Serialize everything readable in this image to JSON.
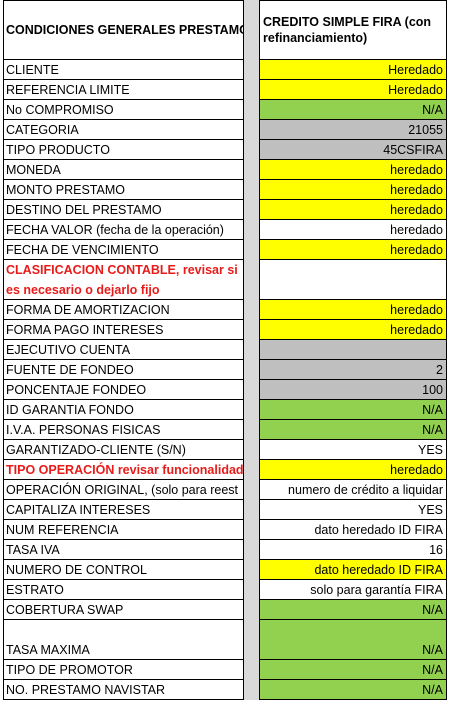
{
  "header": {
    "left": "CONDICIONES GENERALES PRESTAMO",
    "right": "CREDITO SIMPLE FIRA (con refinanciamiento)"
  },
  "rows": [
    {
      "label": "CLIENTE",
      "value": "Heredado",
      "fill": "#ffff00"
    },
    {
      "label": "REFERENCIA LIMITE",
      "value": "Heredado",
      "fill": "#ffff00"
    },
    {
      "label": "No COMPROMISO",
      "value": "N/A",
      "fill": "#92d050"
    },
    {
      "label": "CATEGORIA",
      "value": "21055",
      "fill": "#bfbfbf"
    },
    {
      "label": "TIPO PRODUCTO",
      "value": "45CSFIRA",
      "fill": "#bfbfbf"
    },
    {
      "label": "MONEDA",
      "value": "heredado",
      "fill": "#ffff00"
    },
    {
      "label": "MONTO PRESTAMO",
      "value": "heredado",
      "fill": "#ffff00"
    },
    {
      "label": "DESTINO DEL PRESTAMO",
      "value": "heredado",
      "fill": "#ffff00"
    },
    {
      "label": "FECHA VALOR (fecha de la operación)",
      "value": "heredado",
      "fill": "#ffffff"
    },
    {
      "label": "FECHA DE VENCIMIENTO",
      "value": "heredado",
      "fill": "#ffff00"
    },
    {
      "label": "CLASIFICACION CONTABLE, revisar si es necesario o dejarlo fijo",
      "value": "",
      "fill": "#ffffff",
      "red": true
    },
    {
      "label": "FORMA DE AMORTIZACION",
      "value": "heredado",
      "fill": "#ffff00"
    },
    {
      "label": "FORMA PAGO INTERESES",
      "value": "heredado",
      "fill": "#ffff00"
    },
    {
      "label": "EJECUTIVO CUENTA",
      "value": "",
      "fill": "#bfbfbf"
    },
    {
      "label": "FUENTE DE FONDEO",
      "value": "2",
      "fill": "#bfbfbf"
    },
    {
      "label": "PONCENTAJE FONDEO",
      "value": "100",
      "fill": "#bfbfbf"
    },
    {
      "label": "ID GARANTIA FONDO",
      "value": "N/A",
      "fill": "#92d050"
    },
    {
      "label": "I.V.A. PERSONAS FISICAS",
      "value": "N/A",
      "fill": "#92d050"
    },
    {
      "label": "GARANTIZADO-CLIENTE (S/N)",
      "value": "YES",
      "fill": "#ffffff"
    },
    {
      "label": "TIPO OPERACIÓN revisar funcionalidad",
      "value": "heredado",
      "fill": "#ffff00",
      "red": true
    },
    {
      "label": "OPERACIÓN ORIGINAL, (solo para reest",
      "value": "numero de crédito a liquidar",
      "fill": "#ffffff"
    },
    {
      "label": "CAPITALIZA INTERESES",
      "value": "YES",
      "fill": "#ffffff"
    },
    {
      "label": "NUM REFERENCIA",
      "value": "dato heredado ID FIRA",
      "fill": "#ffffff"
    },
    {
      "label": "TASA IVA",
      "value": "16",
      "fill": "#ffffff"
    },
    {
      "label": "NUMERO DE CONTROL",
      "value": "dato heredado ID FIRA",
      "fill": "#ffff00"
    },
    {
      "label": "ESTRATO",
      "value": "solo para garantía FIRA",
      "fill": "#ffffff"
    },
    {
      "label": "COBERTURA SWAP",
      "value": "N/A",
      "fill": "#92d050"
    },
    {
      "label": "TASA MAXIMA",
      "value": "N/A",
      "fill": "#92d050"
    },
    {
      "label": "TIPO DE PROMOTOR",
      "value": "N/A",
      "fill": "#92d050"
    },
    {
      "label": "NO. PRESTAMO NAVISTAR",
      "value": "N/A",
      "fill": "#92d050"
    }
  ]
}
